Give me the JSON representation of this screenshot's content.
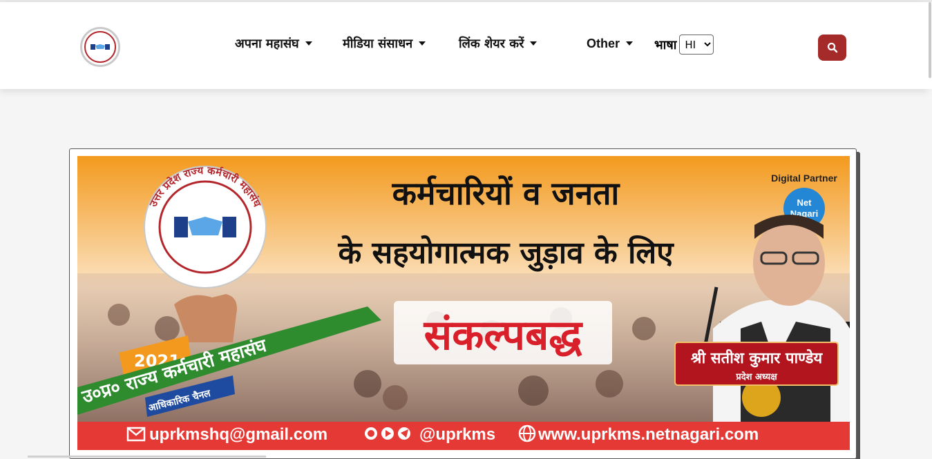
{
  "nav": {
    "menu": [
      {
        "label": "अपना महासंघ"
      },
      {
        "label": "मीडिया संसाधन"
      },
      {
        "label": "लिंक शेयर करें"
      },
      {
        "label": "Other"
      }
    ],
    "language_label": "भाषा",
    "language_value": "HI",
    "search_icon": "search-icon"
  },
  "banner": {
    "logo_text": "उत्तर प्रदेश राज्य कर्मचारी महासंघ",
    "headline_1": "कर्मचारियों व जनता",
    "headline_2": "के सहयोगात्मक जुड़ाव के लिए",
    "highlight": "संकल्पबद्ध",
    "year": "2021",
    "ribbon": "उ०प्र० राज्य कर्मचारी महासंघ",
    "channel": "आधिकारिक चैनल",
    "partner_label": "Digital Partner",
    "partner_name_1": "Net",
    "partner_name_2": "Nagari",
    "person_name": "श्री सतीश कुमार पाण्डेय",
    "person_title": "प्रदेश अध्यक्ष",
    "email": "uprkmshq@gmail.com",
    "social": "@uprkms",
    "website": "www.uprkms.netnagari.com"
  },
  "colors": {
    "brand_red": "#a52a2a",
    "saffron": "#f39a1e",
    "green": "#2e8b2e",
    "footer_red": "#e53935"
  }
}
